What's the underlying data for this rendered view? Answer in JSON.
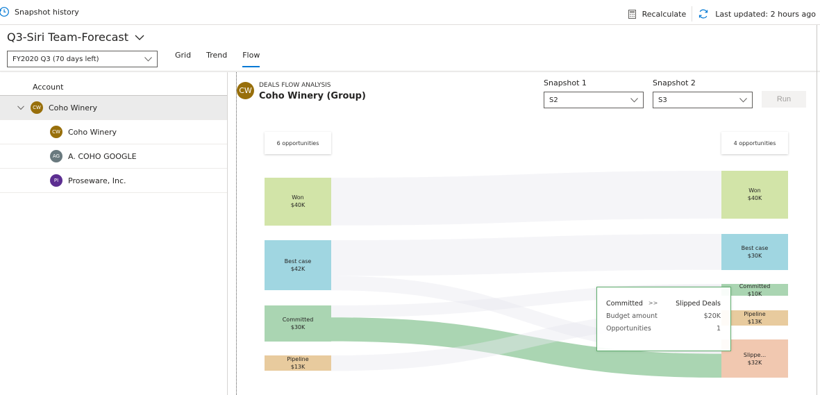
{
  "topbar": {
    "snapshot_history": "Snapshot history",
    "recalculate": "Recalculate",
    "last_updated": "Last updated: 2 hours ago"
  },
  "header": {
    "title": "Q3-Siri Team-Forecast",
    "period": "FY2020 Q3 (70 days left)",
    "tabs": [
      {
        "label": "Grid",
        "active": false
      },
      {
        "label": "Trend",
        "active": false
      },
      {
        "label": "Flow",
        "active": true
      }
    ]
  },
  "accounts": {
    "column_header": "Account",
    "group": {
      "initials": "CW",
      "name": "Coho Winery",
      "color": "#986f0b"
    },
    "children": [
      {
        "initials": "CW",
        "name": "Coho Winery",
        "color": "#986f0b"
      },
      {
        "initials": "AG",
        "name": "A. COHO GOOGLE",
        "color": "#69797e"
      },
      {
        "initials": "PI",
        "name": "Proseware, Inc.",
        "color": "#5c2e91"
      }
    ]
  },
  "flow": {
    "subtitle": "DEALS FLOW ANALYSIS",
    "title": "Coho Winery (Group)",
    "avatar_initials": "CW",
    "snapshot1_label": "Snapshot 1",
    "snapshot1_value": "S2",
    "snapshot2_label": "Snapshot 2",
    "snapshot2_value": "S3",
    "run_label": "Run",
    "left_count": "6 opportunities",
    "right_count": "4 opportunities",
    "left_nodes": [
      {
        "label": "Won",
        "value": "$40K",
        "amount": 40,
        "color": "#d2e4a8"
      },
      {
        "label": "Best case",
        "value": "$42K",
        "amount": 42,
        "color": "#a0d6e1"
      },
      {
        "label": "Committed",
        "value": "$30K",
        "amount": 30,
        "color": "#aad5b2"
      },
      {
        "label": "Pipeline",
        "value": "$13K",
        "amount": 13,
        "color": "#e8cb9e"
      }
    ],
    "right_nodes": [
      {
        "label": "Won",
        "value": "$40K",
        "amount": 40,
        "color": "#d2e4a8"
      },
      {
        "label": "Best case",
        "value": "$30K",
        "amount": 30,
        "color": "#a0d6e1"
      },
      {
        "label": "Committed",
        "value": "$10K",
        "amount": 10,
        "color": "#aad5b2"
      },
      {
        "label": "Pipeline",
        "value": "$13K",
        "amount": 13,
        "color": "#e8cb9e"
      },
      {
        "label": "Slippe...",
        "value": "$32K",
        "amount": 32,
        "color": "#f1c8b0"
      }
    ],
    "links": [
      {
        "from": 0,
        "to": 0,
        "amount": 40,
        "highlight": false
      },
      {
        "from": 1,
        "to": 1,
        "amount": 30,
        "highlight": false
      },
      {
        "from": 1,
        "to": 4,
        "amount": 12,
        "highlight": false
      },
      {
        "from": 2,
        "to": 2,
        "amount": 10,
        "highlight": false
      },
      {
        "from": 2,
        "to": 4,
        "amount": 20,
        "highlight": true
      },
      {
        "from": 3,
        "to": 3,
        "amount": 13,
        "highlight": false
      }
    ],
    "tooltip": {
      "from": "Committed",
      "arrow": ">>",
      "to": "Slipped Deals",
      "rows": [
        {
          "label": "Budget amount",
          "value": "$20K"
        },
        {
          "label": "Opportunities",
          "value": "1"
        }
      ]
    }
  }
}
